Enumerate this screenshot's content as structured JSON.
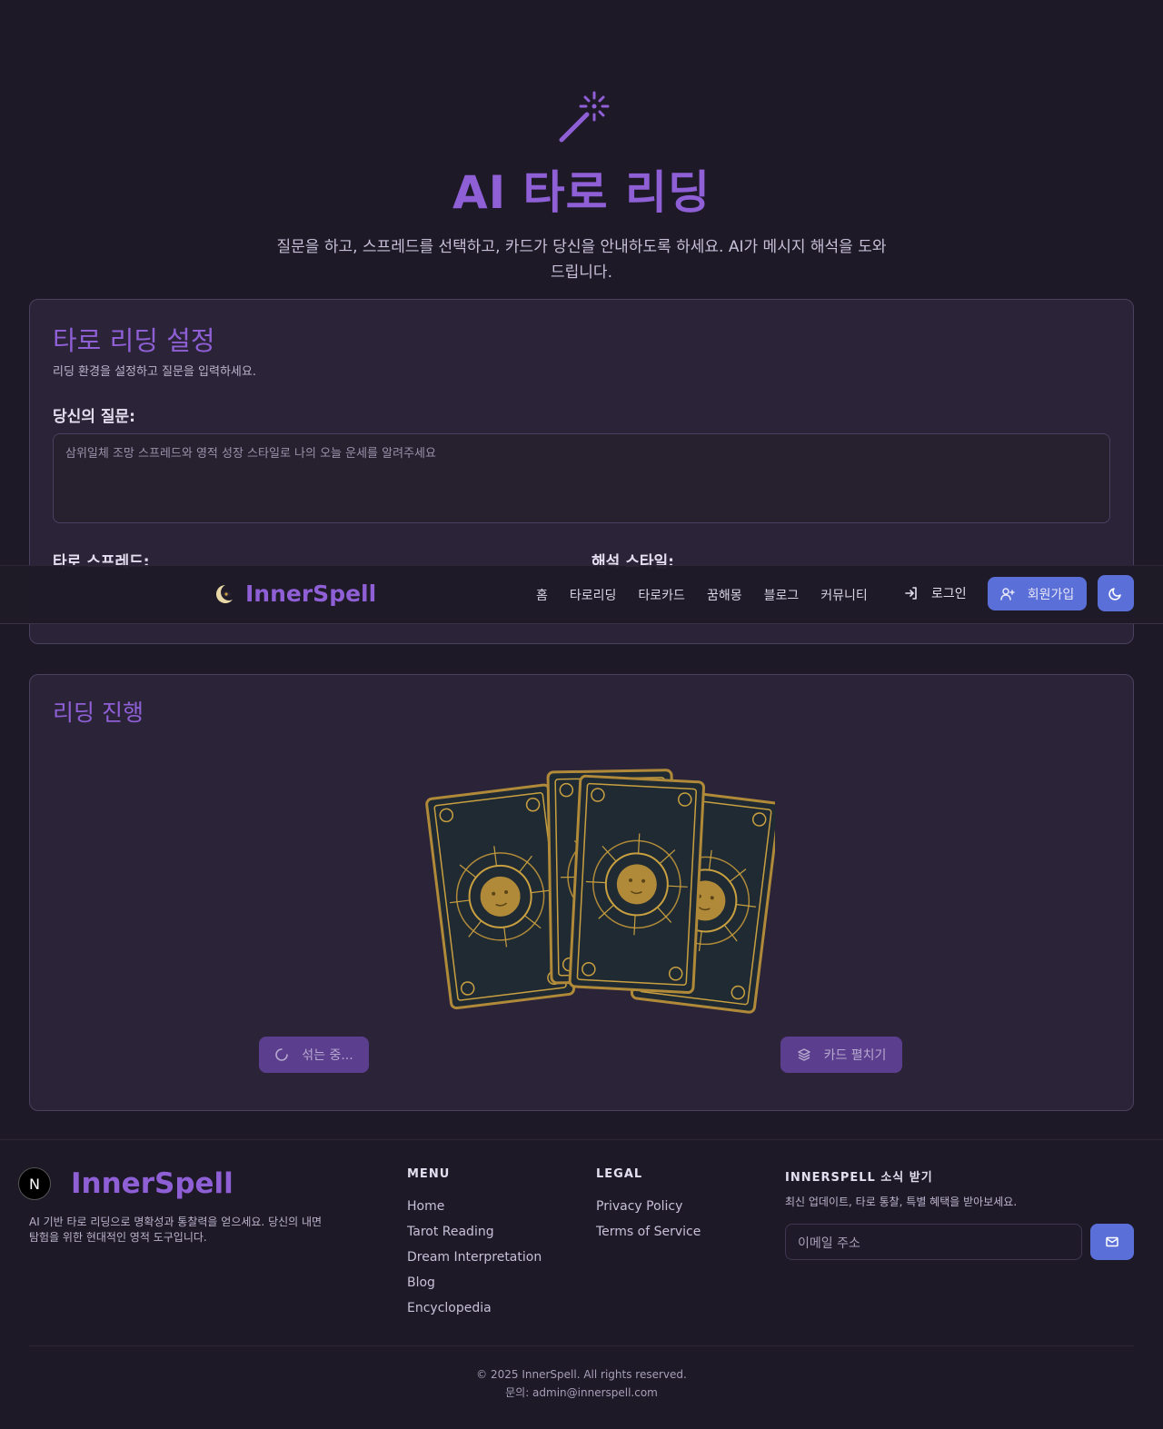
{
  "hero": {
    "icon": "magic-wand-icon",
    "title": "AI 타로 리딩",
    "subtitle": "질문을 하고, 스프레드를 선택하고, 카드가 당신을 안내하도록 하세요. AI가 메시지 해석을 도와드립니다."
  },
  "settings": {
    "title": "타로 리딩 설정",
    "description": "리딩 환경을 설정하고 질문을 입력하세요.",
    "question_label": "당신의 질문:",
    "question_placeholder": "삼위일체 조망 스프레드와 영적 성장 스타일로 나의 오늘 운세를 알려주세요",
    "spread_label": "타로 스프레드:",
    "style_label": "해석 스타일:"
  },
  "navbar": {
    "brand": "InnerSpell",
    "links": [
      "홈",
      "타로리딩",
      "타로카드",
      "꿈해몽",
      "블로그",
      "커뮤니티"
    ],
    "login": "로그인",
    "signup": "회원가입",
    "theme_icon": "moon-icon"
  },
  "reading": {
    "title": "리딩 진행",
    "shuffle_button": "섞는 중...",
    "spread_button": "카드 펼치기"
  },
  "footer": {
    "brand": "InnerSpell",
    "badge": "N",
    "description": "AI 기반 타로 리딩으로 명확성과 통찰력을 얻으세요. 당신의 내면 탐험을 위한 현대적인 영적 도구입니다.",
    "menu_heading": "MENU",
    "menu_links": [
      "Home",
      "Tarot Reading",
      "Dream Interpretation",
      "Blog",
      "Encyclopedia"
    ],
    "legal_heading": "LEGAL",
    "legal_links": [
      "Privacy Policy",
      "Terms of Service"
    ],
    "newsletter_heading": "INNERSPELL 소식 받기",
    "newsletter_desc": "최신 업데이트, 타로 통찰, 특별 혜택을 받아보세요.",
    "email_placeholder": "이메일 주소",
    "copyright": "© 2025 InnerSpell. All rights reserved.",
    "contact": "문의: admin@innerspell.com"
  },
  "colors": {
    "accent": "#8f5fd6",
    "primary_button": "#5a6fd8",
    "background": "#1d1927",
    "card": "#2b2438",
    "gold": "#c9a040"
  }
}
